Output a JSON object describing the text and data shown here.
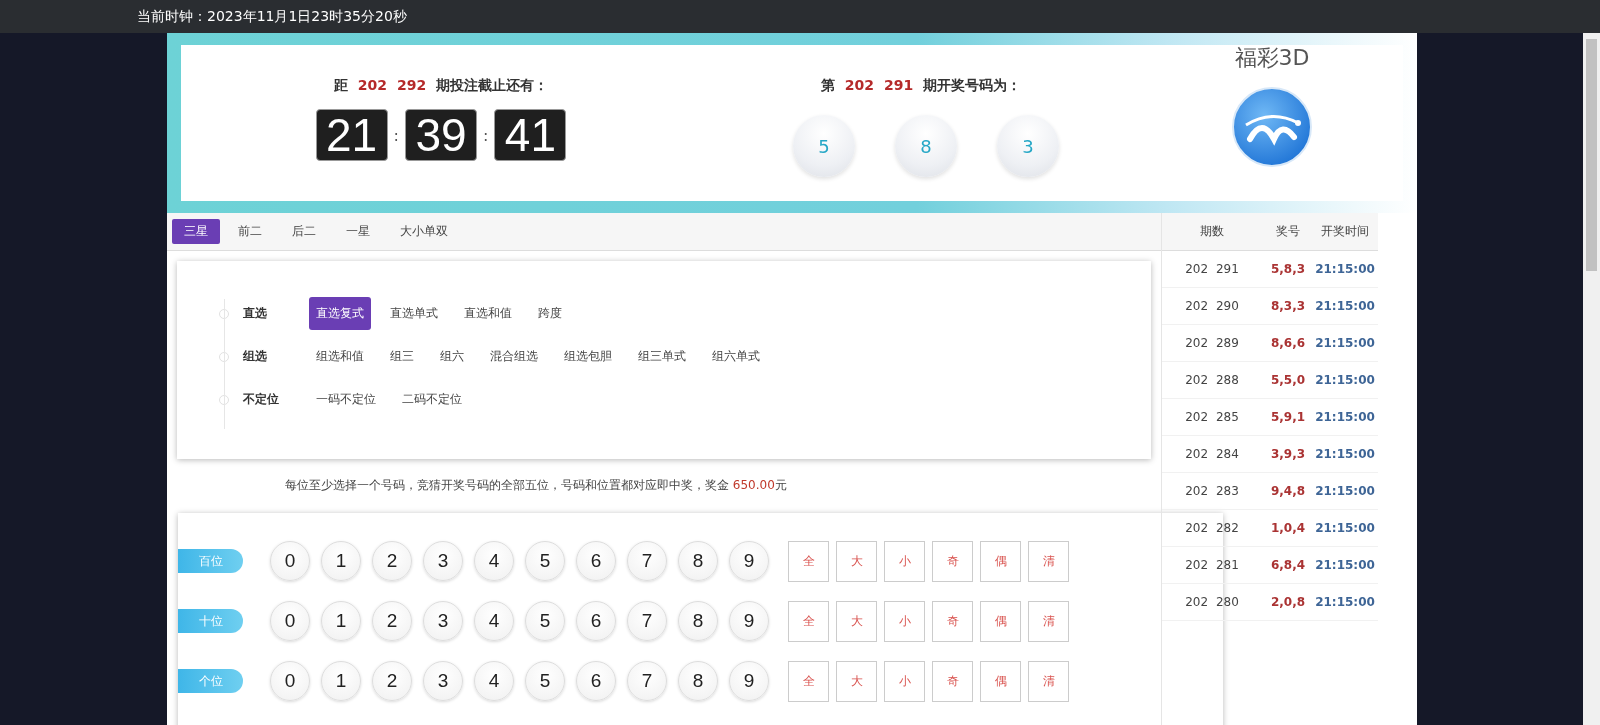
{
  "clock": "当前时钟：2023年11月1日23时35分20秒",
  "countdown": {
    "prefix": "距",
    "issue": [
      "202",
      "292"
    ],
    "suffix": "期投注截止还有：",
    "digits": [
      "21",
      "39",
      "41"
    ],
    "separator": ":"
  },
  "draw": {
    "prefix": "第",
    "issue": [
      "202",
      "291"
    ],
    "suffix": "期开奖号码为：",
    "balls": [
      "5",
      "8",
      "3"
    ]
  },
  "brand": {
    "title": "福彩3D"
  },
  "tabs": [
    {
      "label": "三星",
      "selected": true
    },
    {
      "label": "前二",
      "selected": false
    },
    {
      "label": "后二",
      "selected": false
    },
    {
      "label": "一星",
      "selected": false
    },
    {
      "label": "大小单双",
      "selected": false
    }
  ],
  "play_groups": [
    {
      "label": "直选",
      "options": [
        {
          "label": "直选复式",
          "selected": true
        },
        {
          "label": "直选单式",
          "selected": false
        },
        {
          "label": "直选和值",
          "selected": false
        },
        {
          "label": "跨度",
          "selected": false
        }
      ]
    },
    {
      "label": "组选",
      "options": [
        {
          "label": "组选和值",
          "selected": false
        },
        {
          "label": "组三",
          "selected": false
        },
        {
          "label": "组六",
          "selected": false
        },
        {
          "label": "混合组选",
          "selected": false
        },
        {
          "label": "组选包胆",
          "selected": false
        },
        {
          "label": "组三单式",
          "selected": false
        },
        {
          "label": "组六单式",
          "selected": false
        }
      ]
    },
    {
      "label": "不定位",
      "options": [
        {
          "label": "一码不定位",
          "selected": false
        },
        {
          "label": "二码不定位",
          "selected": false
        }
      ]
    }
  ],
  "hint": {
    "text": "每位至少选择一个号码，竞猜开奖号码的全部五位，号码和位置都对应即中奖，奖金 ",
    "amount": "650.00",
    "unit": "元"
  },
  "positions": [
    {
      "label": "百位",
      "numbers": [
        "0",
        "1",
        "2",
        "3",
        "4",
        "5",
        "6",
        "7",
        "8",
        "9"
      ],
      "quick": [
        "全",
        "大",
        "小",
        "奇",
        "偶",
        "清"
      ]
    },
    {
      "label": "十位",
      "numbers": [
        "0",
        "1",
        "2",
        "3",
        "4",
        "5",
        "6",
        "7",
        "8",
        "9"
      ],
      "quick": [
        "全",
        "大",
        "小",
        "奇",
        "偶",
        "清"
      ]
    },
    {
      "label": "个位",
      "numbers": [
        "0",
        "1",
        "2",
        "3",
        "4",
        "5",
        "6",
        "7",
        "8",
        "9"
      ],
      "quick": [
        "全",
        "大",
        "小",
        "奇",
        "偶",
        "清"
      ]
    }
  ],
  "history": {
    "columns": [
      "期数",
      "奖号",
      "开奖时间"
    ],
    "rows": [
      {
        "issue": "202 291",
        "numbers": "5,8,3",
        "time": "21:15:00"
      },
      {
        "issue": "202 290",
        "numbers": "8,3,3",
        "time": "21:15:00"
      },
      {
        "issue": "202 289",
        "numbers": "8,6,6",
        "time": "21:15:00"
      },
      {
        "issue": "202 288",
        "numbers": "5,5,0",
        "time": "21:15:00"
      },
      {
        "issue": "202 285",
        "numbers": "5,9,1",
        "time": "21:15:00"
      },
      {
        "issue": "202 284",
        "numbers": "3,9,3",
        "time": "21:15:00"
      },
      {
        "issue": "202 283",
        "numbers": "9,4,8",
        "time": "21:15:00"
      },
      {
        "issue": "202 282",
        "numbers": "1,0,4",
        "time": "21:15:00"
      },
      {
        "issue": "202 281",
        "numbers": "6,8,4",
        "time": "21:15:00"
      },
      {
        "issue": "202 280",
        "numbers": "2,0,8",
        "time": "21:15:00"
      }
    ]
  }
}
